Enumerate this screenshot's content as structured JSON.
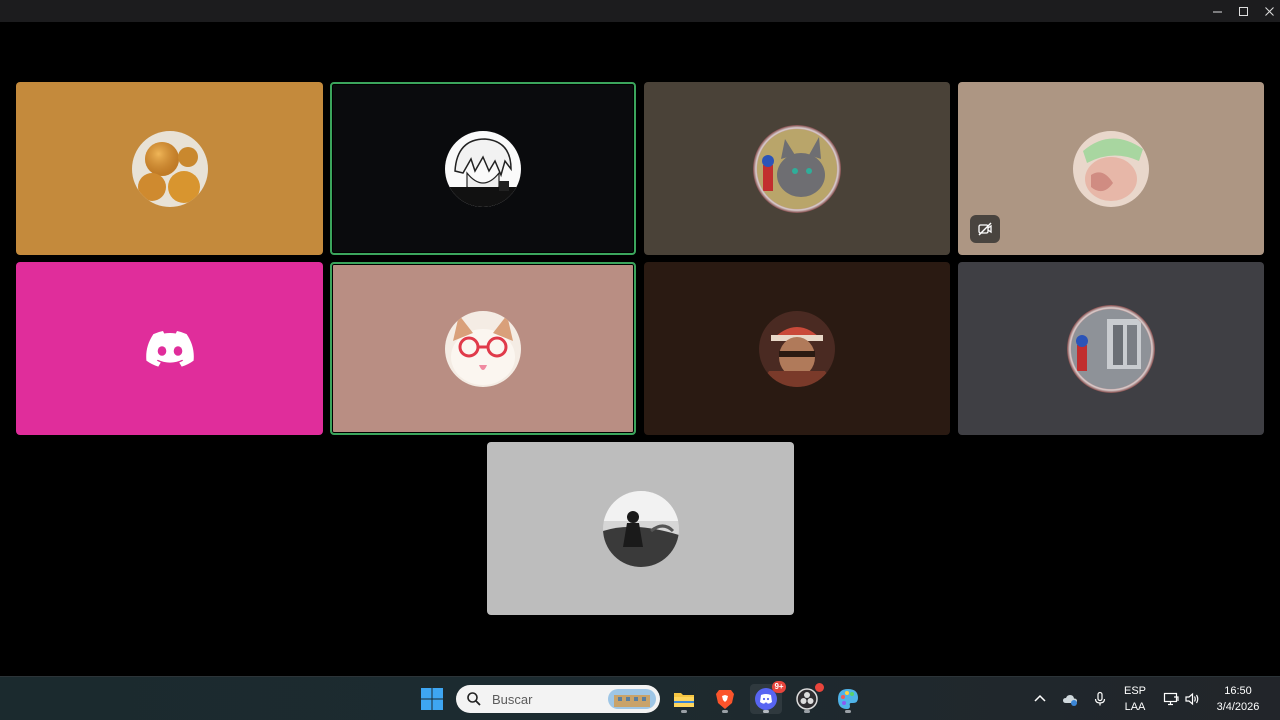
{
  "window": {
    "controls": {
      "minimize": "minimize-icon",
      "maximize": "maximize-icon",
      "close": "close-icon"
    }
  },
  "participants": [
    {
      "id": "p1",
      "bg": "#c48a3c",
      "speaking": false,
      "avatar": "fried-balls-avatar"
    },
    {
      "id": "p2",
      "bg": "#0a0b0d",
      "speaking": true,
      "avatar": "anime-white-hair-avatar"
    },
    {
      "id": "p3",
      "bg": "#4a4238",
      "speaking": false,
      "avatar": "grey-cat-decorated-avatar"
    },
    {
      "id": "p4",
      "bg": "#ad9683",
      "speaking": false,
      "avatar": "cap-selfie-avatar",
      "camera_off": true
    },
    {
      "id": "p5",
      "bg": "#e02d9b",
      "speaking": false,
      "avatar": "discord-default-avatar"
    },
    {
      "id": "p6",
      "bg": "#b98e83",
      "speaking": true,
      "avatar": "cat-glasses-avatar"
    },
    {
      "id": "p7",
      "bg": "#2a1a12",
      "speaking": false,
      "avatar": "beanie-man-avatar"
    },
    {
      "id": "p8",
      "bg": "#3f3f44",
      "speaking": false,
      "avatar": "window-decorated-avatar"
    },
    {
      "id": "p9",
      "bg": "#bdbdbd",
      "speaking": false,
      "avatar": "bw-figure-avatar"
    }
  ],
  "taskbar": {
    "search_placeholder": "Buscar",
    "apps": [
      {
        "name": "file-explorer",
        "icon": "folder-icon",
        "running": true
      },
      {
        "name": "brave",
        "icon": "brave-icon",
        "running": true
      },
      {
        "name": "discord",
        "icon": "discord-icon",
        "running": true,
        "badge": "9+"
      },
      {
        "name": "obs",
        "icon": "obs-icon",
        "running": true,
        "dot": true
      },
      {
        "name": "paint",
        "icon": "palette-icon",
        "running": true
      }
    ],
    "tray": {
      "language": "ESP",
      "layout": "LAA",
      "time": "16:50",
      "date": "3/4/2026"
    }
  }
}
